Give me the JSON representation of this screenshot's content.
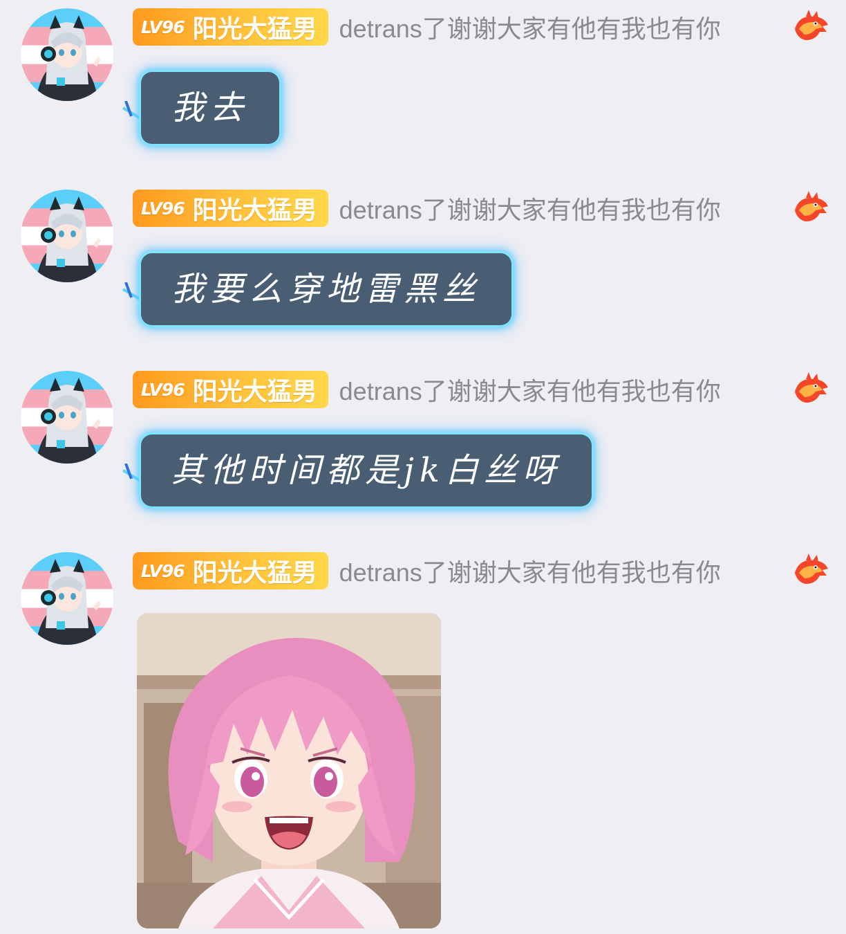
{
  "user": {
    "level": "LV96",
    "name": "阳光大猛男",
    "nickname": "detrans了谢谢大家有他有我也有你",
    "badge_icon": "dragon-icon"
  },
  "messages": [
    {
      "type": "text",
      "text": "我去"
    },
    {
      "type": "text",
      "text": "我要么穿地雷黑丝"
    },
    {
      "type": "text",
      "text": "其他时间都是jk白丝呀"
    },
    {
      "type": "image",
      "alt": "pink-haired-anime-girl-sticker"
    }
  ],
  "colors": {
    "background": "#efeef3",
    "bubble": "#4a5e73",
    "bubble_glow": "#7fe4ff",
    "badge_start": "#ff9a1f",
    "badge_end": "#ffd84a",
    "nickname": "#8a8a8e"
  }
}
